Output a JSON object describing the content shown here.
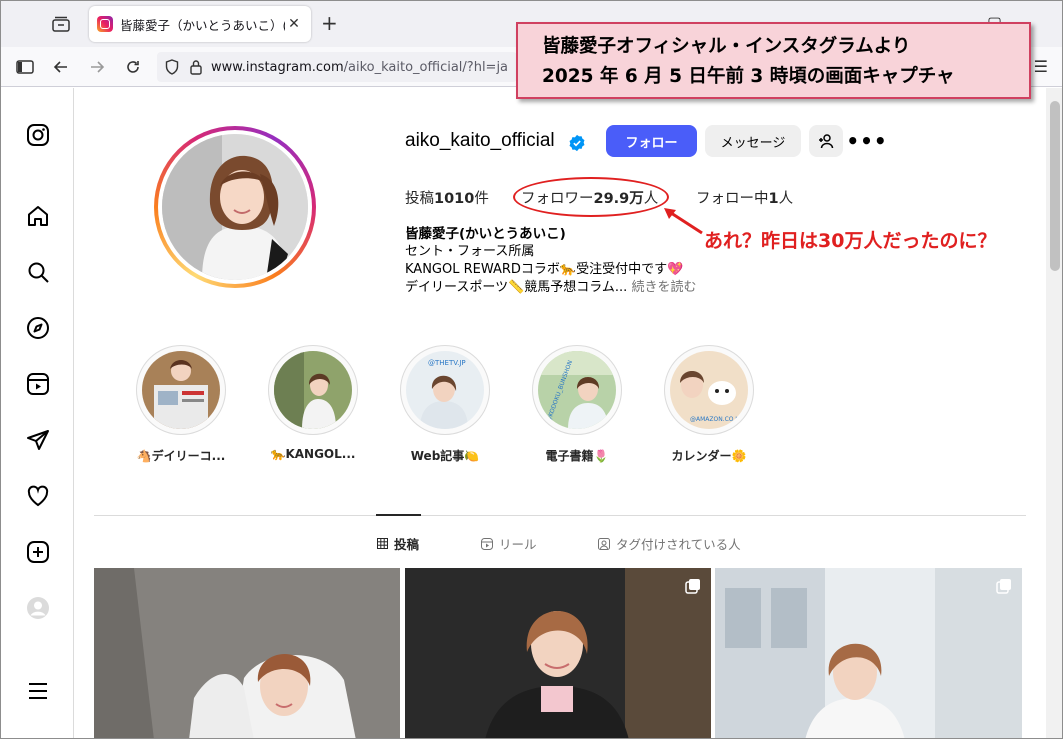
{
  "browser": {
    "tab_title": "皆藤愛子（かいとうあいこ）(@aiko",
    "url_host": "www.instagram.com",
    "url_path": "/aiko_kaito_official/?hl=ja"
  },
  "profile": {
    "username": "aiko_kaito_official",
    "follow_label": "フォロー",
    "message_label": "メッセージ",
    "posts_prefix": "投稿",
    "posts_count": "1010",
    "posts_suffix": "件",
    "followers_prefix": "フォロワー",
    "followers_count": "29.9万",
    "followers_suffix": "人",
    "following_prefix": "フォロー中",
    "following_count": "1",
    "following_suffix": "人",
    "bio_name": "皆藤愛子(かいとうあいこ)",
    "bio_line1": "セント・フォース所属",
    "bio_line2": "KANGOL REWARDコラボ🐆受注受付中です💖",
    "bio_line3": "デイリースポーツ📏競馬予想コラム...",
    "bio_more": "続きを読む"
  },
  "highlights": [
    {
      "label": "🐴デイリーコ..."
    },
    {
      "label": "🐆KANGOL..."
    },
    {
      "label": "Web記事🍋"
    },
    {
      "label": "電子書籍🌷"
    },
    {
      "label": "カレンダー🌼"
    }
  ],
  "highlight_texts": {
    "web": "@THETV.JP",
    "ebook": "@KODOKU_BUNSHON",
    "calendar": "@AMAZON.CO.JP"
  },
  "tabs": {
    "posts": "投稿",
    "reels": "リール",
    "tagged": "タグ付けされている人"
  },
  "annotation": {
    "box_line1": "皆藤愛子オフィシャル・インスタグラムより",
    "box_line2": "2025 年 6 月 5 日午前 3 時頃の画面キャプチャ",
    "callout": "あれ？昨日は30万人だったのに？",
    "accent_color": "#e02020"
  },
  "colors": {
    "follow_button": "#4a5df9",
    "secondary_button": "#efefef",
    "verified": "#0095f6"
  }
}
